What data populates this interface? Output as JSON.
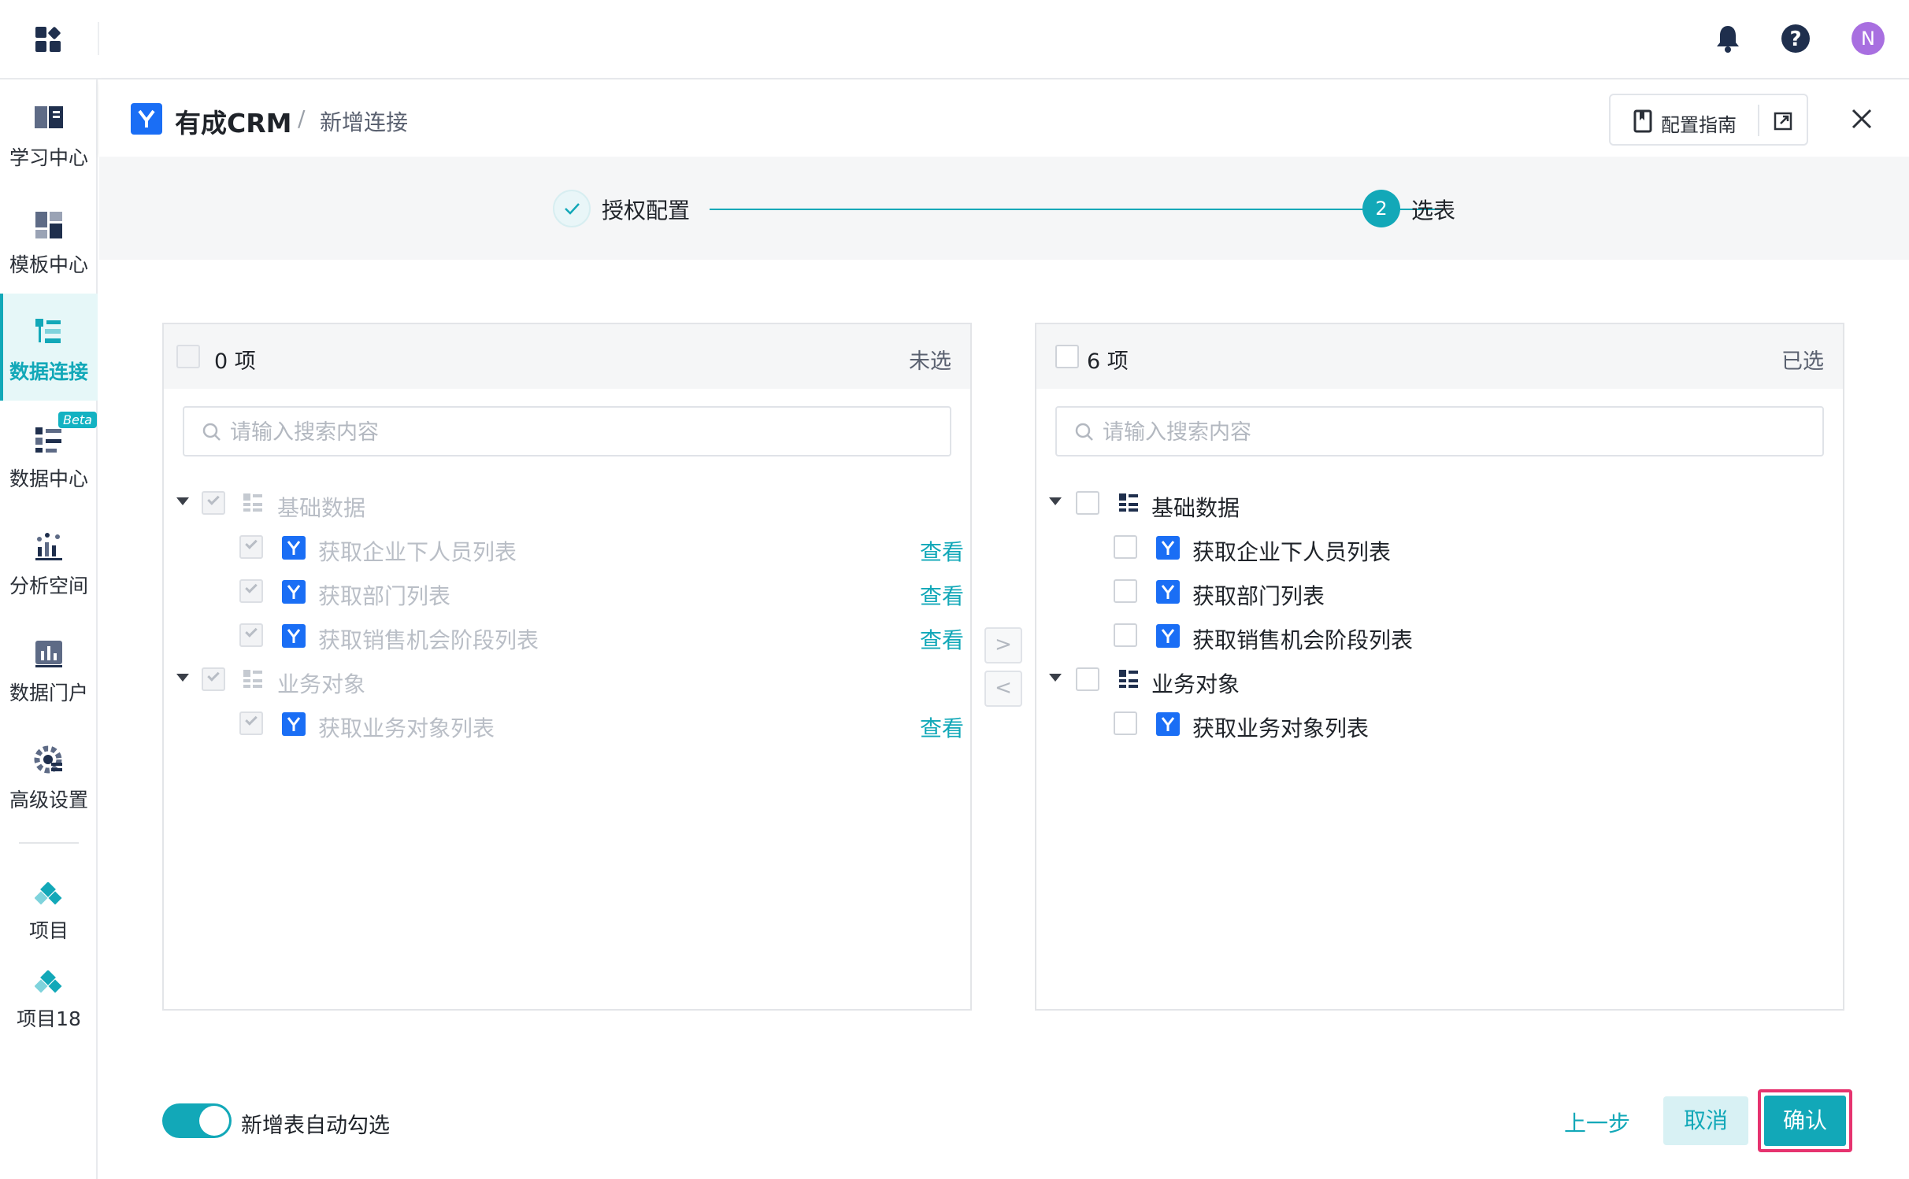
{
  "colors": {
    "accent": "#12a8b8",
    "brand_blue": "#1a6ef5",
    "highlight_border": "#e6336f",
    "avatar": "#a86fe0"
  },
  "topbar": {
    "avatar_initial": "N",
    "icons": [
      "apps-grid-icon",
      "bell-icon",
      "help-icon"
    ]
  },
  "sidebar": {
    "items": [
      {
        "label": "学习中心",
        "icon": "book-icon"
      },
      {
        "label": "模板中心",
        "icon": "template-icon"
      },
      {
        "label": "数据连接",
        "icon": "data-connect-icon",
        "active": true
      },
      {
        "label": "数据中心",
        "icon": "data-center-icon",
        "badge": "Beta"
      },
      {
        "label": "分析空间",
        "icon": "analysis-icon"
      },
      {
        "label": "数据门户",
        "icon": "portal-icon"
      },
      {
        "label": "高级设置",
        "icon": "settings-icon"
      }
    ],
    "projects": [
      {
        "label": "项目",
        "icon": "project-icon"
      },
      {
        "label": "项目18",
        "icon": "project-icon"
      }
    ]
  },
  "header": {
    "app_name": "有成CRM",
    "separator": "/",
    "current": "新增连接",
    "guide_label": "配置指南"
  },
  "steps": [
    {
      "label": "授权配置",
      "status": "done"
    },
    {
      "number": "2",
      "label": "选表",
      "status": "current"
    }
  ],
  "left_panel": {
    "count": "0 项",
    "status": "未选",
    "search_placeholder": "请输入搜索内容",
    "view_label": "查看",
    "groups": [
      {
        "label": "基础数据",
        "items": [
          "获取企业下人员列表",
          "获取部门列表",
          "获取销售机会阶段列表"
        ]
      },
      {
        "label": "业务对象",
        "items": [
          "获取业务对象列表"
        ]
      }
    ]
  },
  "right_panel": {
    "count": "6 项",
    "status": "已选",
    "search_placeholder": "请输入搜索内容",
    "groups": [
      {
        "label": "基础数据",
        "items": [
          "获取企业下人员列表",
          "获取部门列表",
          "获取销售机会阶段列表"
        ]
      },
      {
        "label": "业务对象",
        "items": [
          "获取业务对象列表"
        ]
      }
    ]
  },
  "transfer": {
    "to_right": ">",
    "to_left": "<"
  },
  "footer": {
    "auto_select_label": "新增表自动勾选",
    "auto_select_on": true,
    "prev_label": "上一步",
    "cancel_label": "取消",
    "confirm_label": "确认"
  }
}
